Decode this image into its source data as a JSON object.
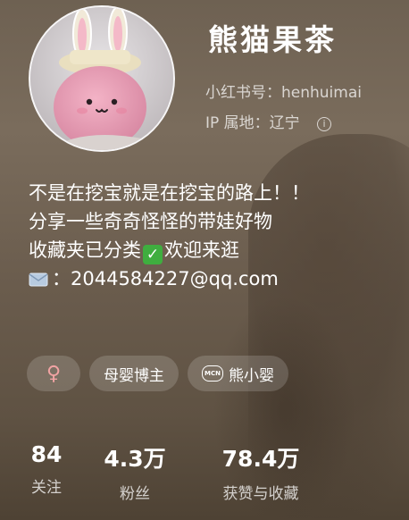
{
  "profile": {
    "name": "熊猫果茶",
    "id_label": "小红书号：henhuimai",
    "ip_label": "IP 属地：辽宁",
    "info_icon": "info-icon"
  },
  "bio": {
    "line1": "不是在挖宝就是在挖宝的路上！！",
    "line2": "分享一些奇奇怪怪的带娃好物",
    "line3_a": "收藏夹已分类",
    "line3_b": "欢迎来逛",
    "line4": "：2044584227@qq.com",
    "check_glyph": "✓"
  },
  "tags": {
    "gender": "♀",
    "category": "母婴博主",
    "mcn_badge": "MCN",
    "mcn": "熊小婴"
  },
  "stats": [
    {
      "num": "84",
      "label": "关注"
    },
    {
      "num": "4.3万",
      "label": "粉丝"
    },
    {
      "num": "78.4万",
      "label": "获赞与收藏"
    }
  ],
  "colors": {
    "background": "#6e6152",
    "check_green": "#3fae3f",
    "gender_pink": "#f1a3a3"
  }
}
